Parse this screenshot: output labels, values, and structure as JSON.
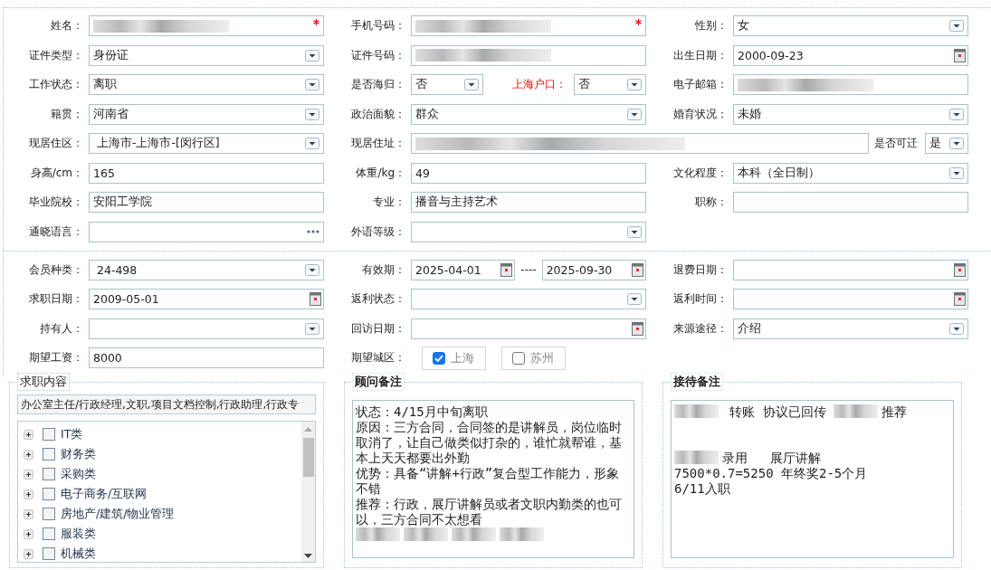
{
  "form_sections": [
    {
      "rows": [
        {
          "cells": [
            {
              "label": "姓名：",
              "parts": [
                {
                  "kind": "text",
                  "redacted": true,
                  "required": true
                }
              ]
            },
            {
              "label": "手机号码：",
              "parts": [
                {
                  "kind": "text",
                  "redacted": true,
                  "required": true
                }
              ]
            },
            {
              "label": "性别：",
              "parts": [
                {
                  "kind": "select",
                  "value": "女"
                }
              ]
            }
          ]
        },
        {
          "cells": [
            {
              "label": "证件类型：",
              "parts": [
                {
                  "kind": "select",
                  "value": "身份证"
                }
              ]
            },
            {
              "label": "证件号码：",
              "parts": [
                {
                  "kind": "text",
                  "redacted": true
                }
              ]
            },
            {
              "label": "出生日期：",
              "parts": [
                {
                  "kind": "date",
                  "value": "2000-09-23"
                }
              ]
            }
          ]
        },
        {
          "cells": [
            {
              "label": "工作状态：",
              "parts": [
                {
                  "kind": "select",
                  "value": "离职"
                }
              ]
            },
            {
              "label": "是否海归：",
              "parts": [
                {
                  "kind": "short_select",
                  "value": "否"
                },
                {
                  "kind": "label",
                  "text": "上海户口：",
                  "emphasis": true
                },
                {
                  "kind": "short_select",
                  "value": "否"
                }
              ]
            },
            {
              "label": "电子邮箱：",
              "parts": [
                {
                  "kind": "text",
                  "redacted": true
                }
              ]
            }
          ]
        },
        {
          "cells": [
            {
              "label": "籍贯：",
              "parts": [
                {
                  "kind": "select",
                  "value": "河南省"
                }
              ]
            },
            {
              "label": "政治面貌：",
              "parts": [
                {
                  "kind": "select",
                  "value": "群众"
                }
              ]
            },
            {
              "label": "婚育状况：",
              "parts": [
                {
                  "kind": "select",
                  "value": "未婚"
                }
              ]
            }
          ]
        },
        {
          "cells": [
            {
              "label": "现居住区：",
              "parts": [
                {
                  "kind": "select",
                  "value": " 上海市-上海市-[闵行区]"
                }
              ]
            },
            {
              "label": "现居住址：",
              "kind": "wide",
              "parts": [
                {
                  "kind": "text",
                  "redacted": true
                },
                {
                  "kind": "label",
                  "text": "是否可迁",
                  "emphasis": false
                },
                {
                  "kind": "tiny_select",
                  "value": "是"
                }
              ]
            }
          ]
        },
        {
          "cells": [
            {
              "label": "身高/cm：",
              "parts": [
                {
                  "kind": "text",
                  "value": "165"
                }
              ]
            },
            {
              "label": "体重/kg：",
              "parts": [
                {
                  "kind": "text",
                  "value": "49"
                }
              ]
            },
            {
              "label": "文化程度：",
              "parts": [
                {
                  "kind": "select",
                  "value": "本科（全日制）"
                }
              ]
            }
          ]
        },
        {
          "cells": [
            {
              "label": "毕业院校：",
              "parts": [
                {
                  "kind": "text",
                  "value": "安阳工学院"
                }
              ]
            },
            {
              "label": "专业：",
              "parts": [
                {
                  "kind": "text",
                  "value": "播音与主持艺术"
                }
              ]
            },
            {
              "label": "职称：",
              "parts": [
                {
                  "kind": "text"
                }
              ]
            }
          ]
        },
        {
          "cells": [
            {
              "label": "通晓语言：",
              "parts": [
                {
                  "kind": "picker"
                }
              ]
            },
            {
              "label": "外语等级：",
              "parts": [
                {
                  "kind": "select"
                }
              ]
            }
          ]
        }
      ]
    },
    {
      "rows": [
        {
          "cells": [
            {
              "label": "会员种类：",
              "parts": [
                {
                  "kind": "select",
                  "value": " 24-498"
                }
              ]
            },
            {
              "label": "有效期：",
              "parts": [
                {
                  "kind": "date",
                  "value": "2025-04-01"
                },
                {
                  "kind": "sep",
                  "text": "----"
                },
                {
                  "kind": "date",
                  "value": "2025-09-30"
                }
              ]
            },
            {
              "label": "退费日期：",
              "parts": [
                {
                  "kind": "date"
                }
              ]
            }
          ]
        },
        {
          "cells": [
            {
              "label": "求职日期：",
              "parts": [
                {
                  "kind": "date",
                  "value": "2009-05-01"
                }
              ]
            },
            {
              "label": "返利状态：",
              "parts": [
                {
                  "kind": "select"
                }
              ]
            },
            {
              "label": "返利时间：",
              "parts": [
                {
                  "kind": "date"
                }
              ]
            }
          ]
        },
        {
          "cells": [
            {
              "label": "持有人：",
              "parts": [
                {
                  "kind": "select"
                }
              ]
            },
            {
              "label": "回访日期：",
              "parts": [
                {
                  "kind": "date"
                }
              ]
            },
            {
              "label": "来源途径：",
              "parts": [
                {
                  "kind": "select",
                  "value": "介绍"
                }
              ]
            }
          ]
        },
        {
          "cells": [
            {
              "label": "期望工资：",
              "parts": [
                {
                  "kind": "text",
                  "value": "8000"
                }
              ]
            },
            {
              "label": "期望城区：",
              "parts": [
                {
                  "kind": "checkbutton",
                  "text": "上海",
                  "checked": true
                },
                {
                  "kind": "checkbutton",
                  "text": "苏州",
                  "checked": false
                }
              ]
            }
          ]
        }
      ]
    }
  ],
  "panels": [
    {
      "kind": "job_tree",
      "legend": "求职内容",
      "summary": "办公室主任/行政经理,文职,项目文档控制,行政助理,行政专",
      "items": [
        {
          "label": "IT类",
          "checked": false,
          "expanded": false
        },
        {
          "label": "财务类",
          "checked": false,
          "expanded": false
        },
        {
          "label": "采购类",
          "checked": false,
          "expanded": false
        },
        {
          "label": "电子商务/互联网",
          "checked": false,
          "expanded": false
        },
        {
          "label": "房地产/建筑/物业管理",
          "checked": false,
          "expanded": false
        },
        {
          "label": "服装类",
          "checked": false,
          "expanded": false
        },
        {
          "label": "机械类",
          "checked": false,
          "expanded": false
        }
      ]
    },
    {
      "kind": "notes",
      "legend": "顾问备注",
      "lines": [
        {
          "kind": "text",
          "segments": [
            {
              "text": "状态：4/15月中旬离职"
            }
          ]
        },
        {
          "kind": "text",
          "segments": [
            {
              "text": "原因：三方合同，合同签的是讲解员，岗位临时取消了，让自己做类似打杂的，谁忙就帮谁，基本上天天都要出外勤"
            }
          ]
        },
        {
          "kind": "text",
          "segments": [
            {
              "text": "优势：具备“讲解+行政”复合型工作能力，形象不错"
            }
          ]
        },
        {
          "kind": "text",
          "segments": [
            {
              "text": "推荐：行政，展厅讲解员或者文职内勤类的也可以，三方合同不太想看"
            }
          ]
        },
        {
          "kind": "text",
          "segments": [
            {
              "redacted": true
            },
            {
              "redacted": true
            },
            {
              "redacted": true
            },
            {
              "redacted": true
            }
          ]
        }
      ]
    },
    {
      "kind": "notes",
      "legend": "接待备注",
      "lines": [
        {
          "kind": "text",
          "segments": [
            {
              "redacted": true
            },
            {
              "text": " 转账 协议已回传 "
            },
            {
              "redacted": true
            },
            {
              "text": "推荐"
            }
          ]
        },
        {
          "kind": "blank"
        },
        {
          "kind": "blank"
        },
        {
          "kind": "text",
          "segments": [
            {
              "redacted": true
            },
            {
              "text": "录用   展厅讲解"
            }
          ]
        },
        {
          "kind": "text",
          "segments": [
            {
              "text": "7500*0.7=5250 年终奖2-5个月"
            }
          ]
        },
        {
          "kind": "text",
          "segments": [
            {
              "text": "6/11入职"
            }
          ]
        }
      ]
    }
  ]
}
